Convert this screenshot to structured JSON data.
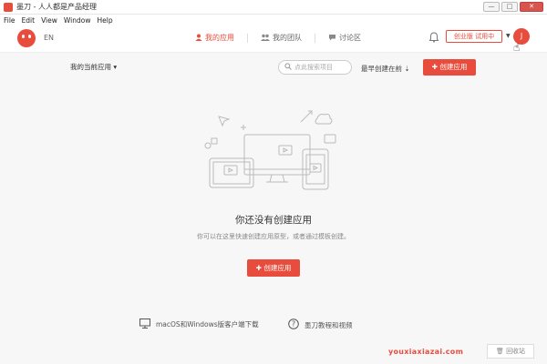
{
  "window": {
    "title": "墨刀 - 人人都是产品经理",
    "controls": [
      "—",
      "□",
      "✕"
    ]
  },
  "menu": [
    "File",
    "Edit",
    "View",
    "Window",
    "Help"
  ],
  "header": {
    "lang": "EN",
    "nav": [
      {
        "label": "我的应用",
        "icon": "user-icon",
        "active": true
      },
      {
        "label": "我的团队",
        "icon": "team-icon",
        "active": false
      },
      {
        "label": "讨论区",
        "icon": "chat-icon",
        "active": false
      }
    ],
    "plan_label": "创业版 试用中",
    "avatar_initial": "J"
  },
  "toolbar": {
    "current_apps": "我的当前应用",
    "search_placeholder": "点此搜索项目",
    "sort_label": "最早创建在前",
    "create_label": "创建应用"
  },
  "empty": {
    "title": "你还没有创建应用",
    "subtitle": "你可以在这里快速创建应用原型，或者通过模板创建。",
    "create_label": "创建应用"
  },
  "footer": {
    "download_label": "macOS和Windows版客户端下载",
    "tutorial_label": "墨刀教程和视频",
    "watermark": "youxiaxiazai.com",
    "trash_label": "回收站"
  },
  "colors": {
    "accent": "#e84c3d",
    "background": "#f7f7f7"
  }
}
